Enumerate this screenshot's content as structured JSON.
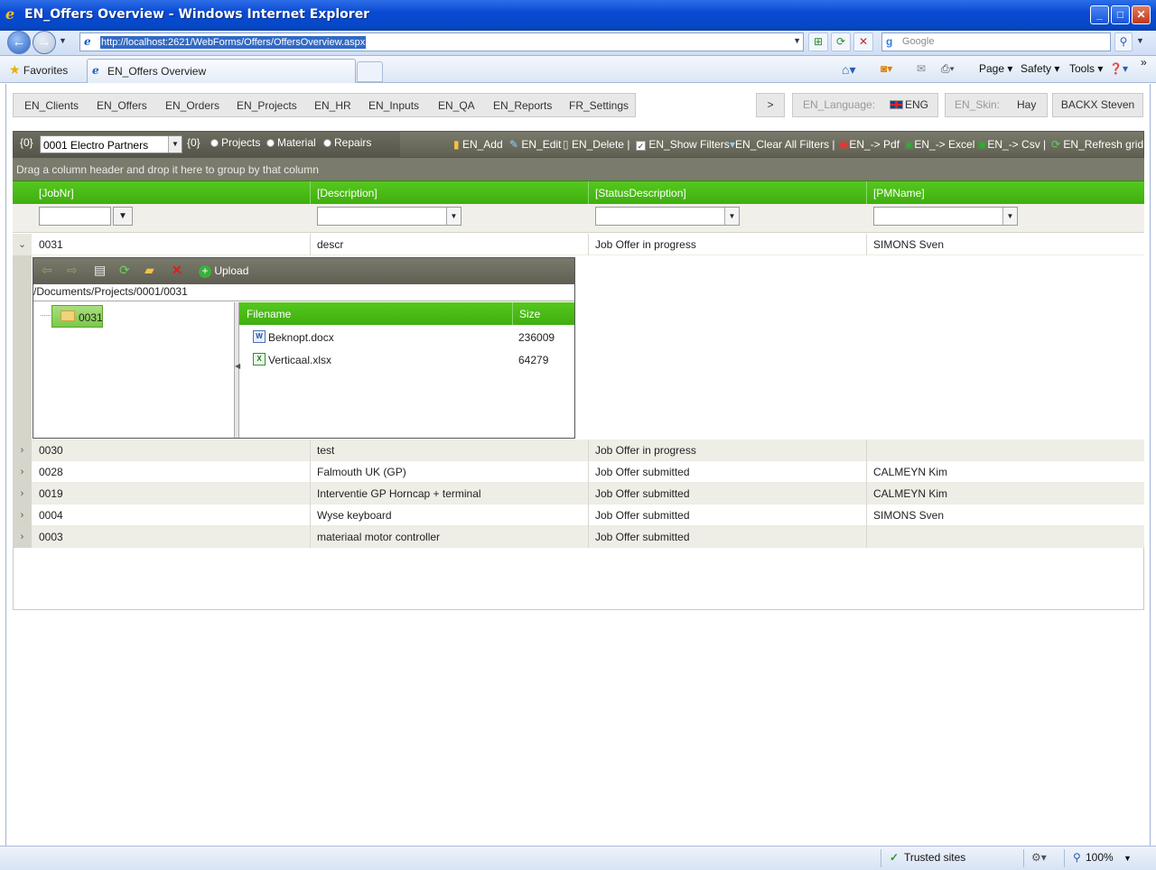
{
  "window": {
    "title": "EN_Offers Overview - Windows Internet Explorer"
  },
  "browser": {
    "url": "http://localhost:2621/WebForms/Offers/OffersOverview.aspx",
    "search_placeholder": "Google",
    "favorites_label": "Favorites",
    "tab_title": "EN_Offers Overview",
    "commands": {
      "page": "Page",
      "safety": "Safety",
      "tools": "Tools"
    }
  },
  "app_menu": {
    "items": [
      "EN_Clients",
      "EN_Offers",
      "EN_Orders",
      "EN_Projects",
      "EN_HR",
      "EN_Inputs",
      "EN_QA",
      "EN_Reports",
      "FR_Settings"
    ],
    "more": ">",
    "language_label": "EN_Language:",
    "language_value": "ENG",
    "skin_label": "EN_Skin:",
    "skin_value": "Hay",
    "user": "BACKX Steven"
  },
  "toolbar": {
    "prefix1": "{0}",
    "client_select": "0001  Electro Partners",
    "prefix2": "{0}",
    "radio_projects": "Projects",
    "radio_material": "Material",
    "radio_repairs": "Repairs",
    "add": "EN_Add",
    "edit": "EN_Edit",
    "delete": "EN_Delete |",
    "show_filters": "EN_Show Filters",
    "clear_filters": "EN_Clear All Filters |",
    "pdf": "EN_-> Pdf",
    "excel": "EN_-> Excel",
    "csv": "EN_-> Csv |",
    "refresh": "EN_Refresh grid"
  },
  "grid": {
    "group_hint": "Drag a column header and drop it here to group by that column",
    "columns": [
      "[JobNr]",
      "[Description]",
      "[StatusDescription]",
      "[PMName]"
    ],
    "expanded_row": {
      "job": "0031",
      "desc": "descr",
      "status": "Job Offer in progress",
      "pm": "SIMONS Sven"
    },
    "rows": [
      {
        "job": "0030",
        "desc": "test",
        "status": "Job Offer in progress",
        "pm": ""
      },
      {
        "job": "0028",
        "desc": "Falmouth UK (GP)",
        "status": "Job Offer submitted",
        "pm": "CALMEYN Kim"
      },
      {
        "job": "0019",
        "desc": "Interventie GP Horncap + terminal",
        "status": "Job Offer submitted",
        "pm": "CALMEYN Kim"
      },
      {
        "job": "0004",
        "desc": "Wyse keyboard",
        "status": "Job Offer submitted",
        "pm": "SIMONS Sven"
      },
      {
        "job": "0003",
        "desc": "materiaal motor controller",
        "status": "Job Offer submitted",
        "pm": ""
      }
    ]
  },
  "file_manager": {
    "upload_label": "Upload",
    "path": "/Documents/Projects/0001/0031",
    "folder": "0031",
    "headers": {
      "filename": "Filename",
      "size": "Size"
    },
    "files": [
      {
        "name": "Beknopt.docx",
        "size": "236009"
      },
      {
        "name": "Verticaal.xlsx",
        "size": "64279"
      }
    ]
  },
  "statusbar": {
    "zone": "Trusted sites",
    "zoom": "100%"
  }
}
